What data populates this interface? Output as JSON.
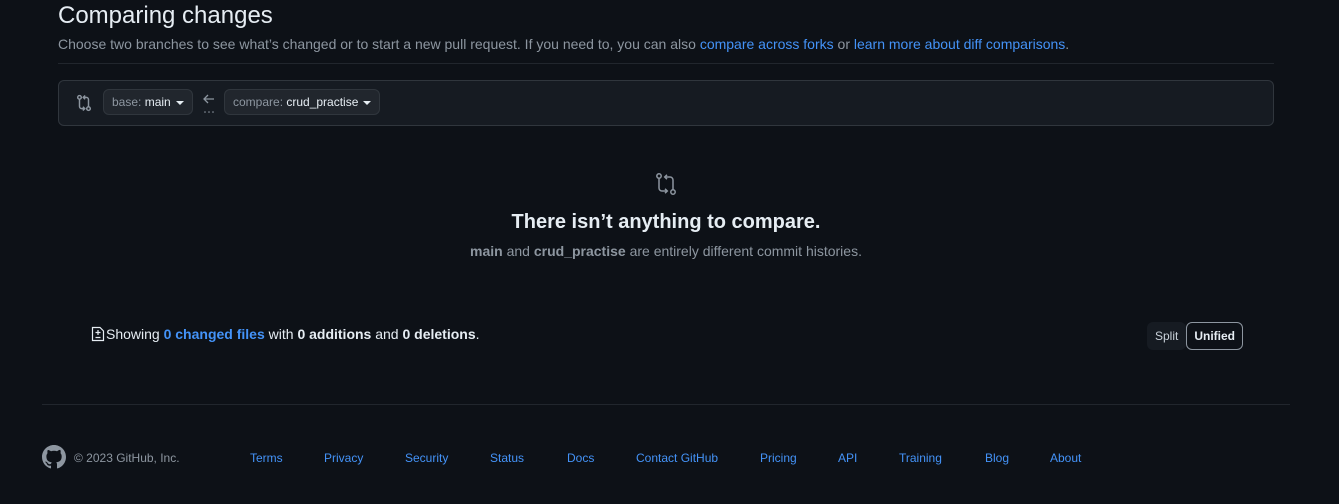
{
  "header": {
    "title": "Comparing changes",
    "subtitle_text": "Choose two branches to see what’s changed or to start a new pull request. If you need to, you can also ",
    "link_compare_forks": "compare across forks",
    "subtitle_or": " or ",
    "link_learn_more": "learn more about diff comparisons",
    "subtitle_end": "."
  },
  "range": {
    "base_label": "base: ",
    "base_value": "main",
    "compare_label": "compare: ",
    "compare_value": "crud_practise"
  },
  "blankslate": {
    "title": "There isn’t anything to compare.",
    "branch_a": "main",
    "and": " and ",
    "branch_b": "crud_practise",
    "rest": " are entirely different commit histories."
  },
  "stats": {
    "showing": "Showing ",
    "changed_files": "0 changed files",
    "with": " with ",
    "additions": "0 additions",
    "and": " and ",
    "deletions": "0 deletions",
    "period": "."
  },
  "view_toggle": {
    "split": "Split",
    "unified": "Unified",
    "selected": "Unified"
  },
  "footer": {
    "copyright": "© 2023 GitHub, Inc.",
    "links": [
      "Terms",
      "Privacy",
      "Security",
      "Status",
      "Docs",
      "Contact GitHub",
      "Pricing",
      "API",
      "Training",
      "Blog",
      "About"
    ]
  },
  "colors": {
    "background": "#0d1117",
    "link": "#4493f8",
    "muted": "#8d96a0",
    "border": "#30363d"
  },
  "icons": [
    "git-compare-icon",
    "arrow-left-icon",
    "file-diff-icon",
    "github-mark-icon",
    "caret-down-icon"
  ]
}
